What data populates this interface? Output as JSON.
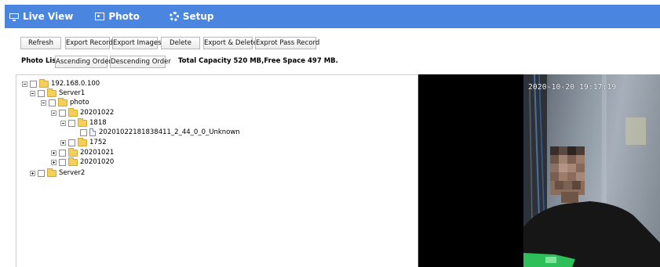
{
  "nav": {
    "live_view": "Live View",
    "photo": "Photo",
    "setup": "Setup"
  },
  "toolbar": {
    "refresh": "Refresh",
    "export_record": "Export Record",
    "export_images": "Export Images",
    "delete": "Delete",
    "export_delete": "Export & Delete",
    "export_pass_record": "Exprot Pass Record"
  },
  "photo_list": {
    "label": "Photo List",
    "ascending": "Ascending Order",
    "descending": "Descending Order",
    "capacity": "Total Capacity 520 MB,Free Space 497 MB."
  },
  "tree": {
    "root": "192.168.0.100",
    "server1": "Server1",
    "photo": "photo",
    "d20201022": "20201022",
    "f1818": "1818",
    "file1": "20201022181838411_2_44_0_0_Unknown",
    "f1752": "1752",
    "d20201021": "20201021",
    "d20201020": "20201020",
    "server2": "Server2"
  },
  "preview": {
    "timestamp": "2020-10-20 19:17:19"
  },
  "colors": {
    "nav_bg": "#4a86e0",
    "folder": "#f4cf5a"
  }
}
